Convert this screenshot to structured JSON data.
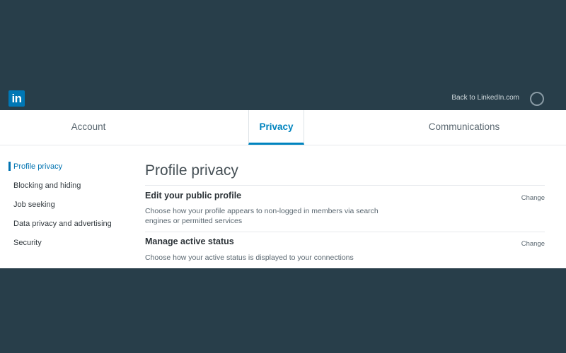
{
  "header": {
    "logo_text": "in",
    "back_link": "Back to LinkedIn.com"
  },
  "tabs": [
    {
      "label": "Account",
      "active": false
    },
    {
      "label": "Privacy",
      "active": true
    },
    {
      "label": "Communications",
      "active": false
    }
  ],
  "sidebar": {
    "items": [
      {
        "label": "Profile privacy",
        "active": true
      },
      {
        "label": "Blocking and hiding",
        "active": false
      },
      {
        "label": "Job seeking",
        "active": false
      },
      {
        "label": "Data privacy and advertising",
        "active": false
      },
      {
        "label": "Security",
        "active": false
      }
    ]
  },
  "main": {
    "title": "Profile privacy",
    "sections": [
      {
        "title": "Edit your public profile",
        "description": "Choose how your profile appears to non-logged in members via search engines or permitted services",
        "action": "Change"
      },
      {
        "title": "Manage active status",
        "description": "Choose how your active status is displayed to your connections",
        "action": "Change"
      }
    ]
  },
  "colors": {
    "background_dark": "#283e4a",
    "brand_blue": "#0077b5",
    "accent_active": "#0084bf"
  },
  "icons": {
    "logo": "linkedin-logo-icon",
    "avatar": "profile-avatar"
  }
}
